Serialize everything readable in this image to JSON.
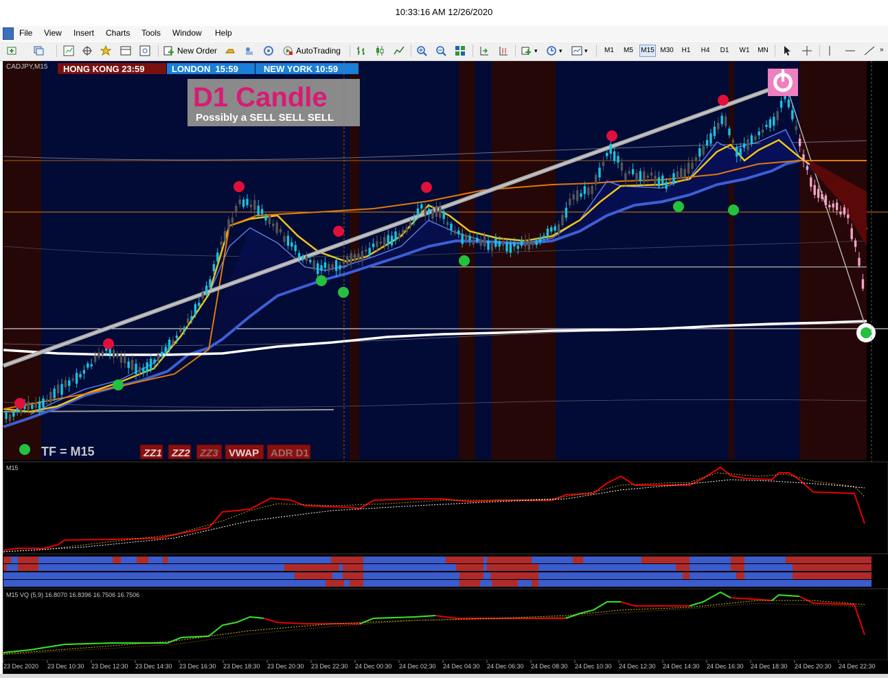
{
  "window": {
    "title": "10:33:16 AM 12/26/2020"
  },
  "menu": [
    "File",
    "View",
    "Insert",
    "Charts",
    "Tools",
    "Window",
    "Help"
  ],
  "toolbar": {
    "new_order": "New Order",
    "autotrading": "AutoTrading",
    "timeframes": [
      "M1",
      "M5",
      "M15",
      "M30",
      "H1",
      "H4",
      "D1",
      "W1",
      "MN"
    ],
    "active_timeframe": "M15"
  },
  "chart": {
    "symbol": "CADJPY,M15",
    "sessions": [
      {
        "label": "HONG KONG 23:59",
        "color": "#7a1010"
      },
      {
        "label": "LONDON  15:59",
        "color": "#1a7fd6"
      },
      {
        "label": "NEW YORK 10:59",
        "color": "#1a7fd6"
      }
    ],
    "d1_title": "D1 Candle",
    "d1_subtitle": "Possibly a SELL SELL SELL",
    "tf_label": "TF = M15",
    "buttons": [
      "ZZ1",
      "ZZ2",
      "ZZ3",
      "VWAP",
      "ADR D1"
    ],
    "colors": {
      "bull": "#19c3de",
      "bear_dark": "#555555",
      "bear_pink": "#f5a3c8",
      "down_dot": "#e0103a",
      "up_dot": "#22c13e"
    }
  },
  "panel1": {
    "label": "M15"
  },
  "panel3": {
    "label": "M15 VQ (5,9) 16.8070 16.8396 16.7506 16.7506"
  },
  "time_axis": [
    "23 Dec 2020",
    "23 Dec 10:30",
    "23 Dec 12:30",
    "23 Dec 14:30",
    "23 Dec 16:30",
    "23 Dec 18:30",
    "23 Dec 20:30",
    "23 Dec 22:30",
    "24 Dec 00:30",
    "24 Dec 02:30",
    "24 Dec 04:30",
    "24 Dec 06:30",
    "24 Dec 08:30",
    "24 Dec 10:30",
    "24 Dec 12:30",
    "24 Dec 14:30",
    "24 Dec 16:30",
    "24 Dec 18:30",
    "24 Dec 20:30",
    "24 Dec 22:30"
  ]
}
